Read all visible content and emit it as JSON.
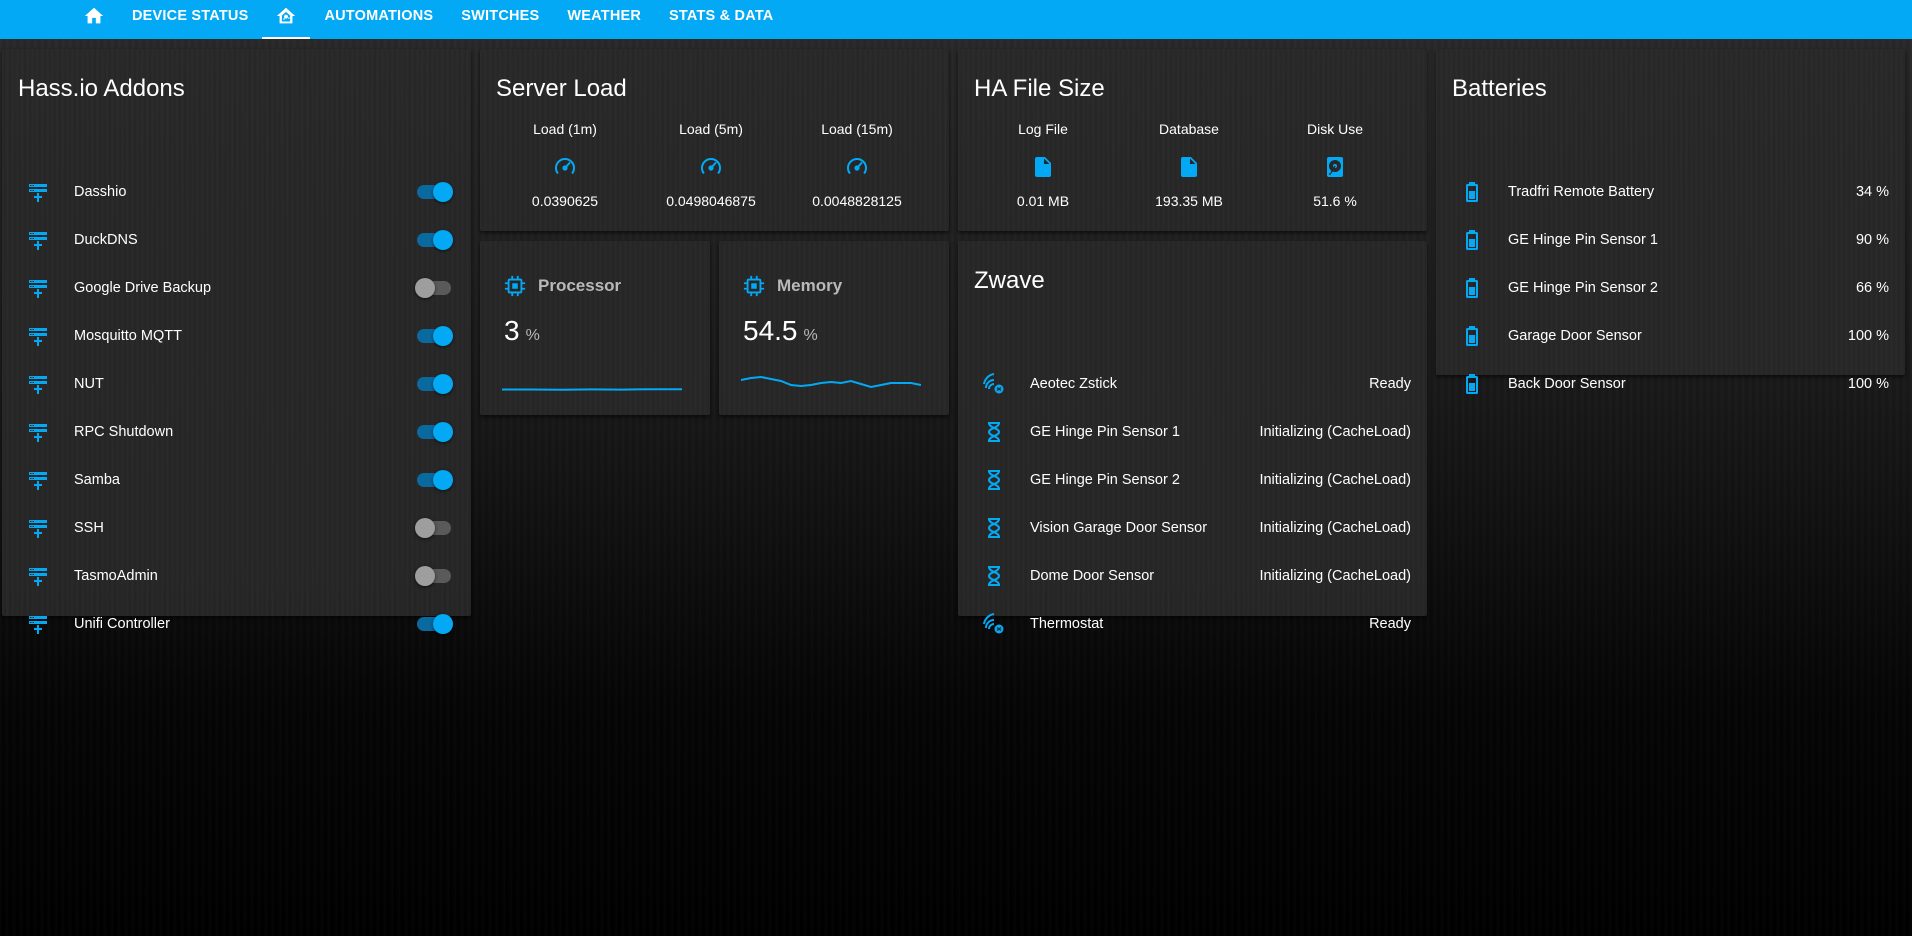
{
  "colors": {
    "accent": "#03a9f4",
    "card": "#282828",
    "text": "#ffffff"
  },
  "nav": {
    "tabs": [
      {
        "type": "icon",
        "icon": "home-icon"
      },
      {
        "type": "text",
        "label": "DEVICE STATUS"
      },
      {
        "type": "icon",
        "icon": "home-automation-icon",
        "active": true
      },
      {
        "type": "text",
        "label": "AUTOMATIONS"
      },
      {
        "type": "text",
        "label": "SWITCHES"
      },
      {
        "type": "text",
        "label": "WEATHER"
      },
      {
        "type": "text",
        "label": "STATS & DATA"
      }
    ]
  },
  "addons": {
    "title": "Hass.io Addons",
    "items": [
      {
        "label": "Dasshio",
        "on": true
      },
      {
        "label": "DuckDNS",
        "on": true
      },
      {
        "label": "Google Drive Backup",
        "on": false
      },
      {
        "label": "Mosquitto MQTT",
        "on": true
      },
      {
        "label": "NUT",
        "on": true
      },
      {
        "label": "RPC Shutdown",
        "on": true
      },
      {
        "label": "Samba",
        "on": true
      },
      {
        "label": "SSH",
        "on": false
      },
      {
        "label": "TasmoAdmin",
        "on": false
      },
      {
        "label": "Unifi Controller",
        "on": true
      }
    ]
  },
  "server_load": {
    "title": "Server Load",
    "cols": [
      {
        "name": "Load (1m)",
        "value": "0.0390625",
        "icon": "gauge-icon"
      },
      {
        "name": "Load (5m)",
        "value": "0.0498046875",
        "icon": "gauge-icon"
      },
      {
        "name": "Load (15m)",
        "value": "0.0048828125",
        "icon": "gauge-icon"
      }
    ]
  },
  "file_size": {
    "title": "HA File Size",
    "cols": [
      {
        "name": "Log File",
        "value": "0.01 MB",
        "icon": "file-icon"
      },
      {
        "name": "Database",
        "value": "193.35 MB",
        "icon": "file-icon"
      },
      {
        "name": "Disk Use",
        "value": "51.6 %",
        "icon": "harddisk-icon"
      }
    ]
  },
  "processor": {
    "name": "Processor",
    "value": "3",
    "unit": "%",
    "icon": "chip-icon"
  },
  "memory": {
    "name": "Memory",
    "value": "54.5",
    "unit": "%",
    "icon": "chip-icon"
  },
  "zwave": {
    "title": "Zwave",
    "items": [
      {
        "label": "Aeotec Zstick",
        "status": "Ready",
        "icon": "zwave-icon"
      },
      {
        "label": "GE Hinge Pin Sensor 1",
        "status": "Initializing (CacheLoad)",
        "icon": "hourglass-icon"
      },
      {
        "label": "GE Hinge Pin Sensor 2",
        "status": "Initializing (CacheLoad)",
        "icon": "hourglass-icon"
      },
      {
        "label": "Vision Garage Door Sensor",
        "status": "Initializing (CacheLoad)",
        "icon": "hourglass-icon"
      },
      {
        "label": "Dome Door Sensor",
        "status": "Initializing (CacheLoad)",
        "icon": "hourglass-icon"
      },
      {
        "label": "Thermostat",
        "status": "Ready",
        "icon": "zwave-icon"
      }
    ]
  },
  "batteries": {
    "title": "Batteries",
    "items": [
      {
        "label": "Tradfri Remote Battery",
        "value": "34 %"
      },
      {
        "label": "GE Hinge Pin Sensor 1",
        "value": "90 %"
      },
      {
        "label": "GE Hinge Pin Sensor 2",
        "value": "66 %"
      },
      {
        "label": "Garage Door Sensor",
        "value": "100 %"
      },
      {
        "label": "Back Door Sensor",
        "value": "100 %"
      }
    ]
  }
}
